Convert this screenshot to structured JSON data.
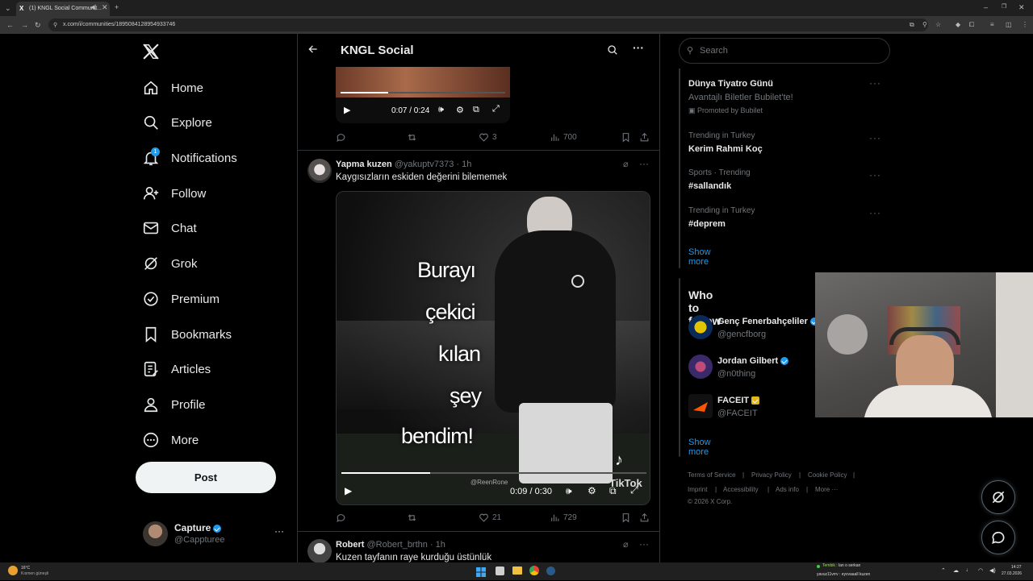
{
  "browser": {
    "tab_title": "(1) KNGL Social Communit...",
    "url": "x.com/i/communities/1895084128954933746"
  },
  "nav": {
    "items": [
      {
        "label": "Home"
      },
      {
        "label": "Explore"
      },
      {
        "label": "Notifications",
        "badge": "1"
      },
      {
        "label": "Follow"
      },
      {
        "label": "Chat"
      },
      {
        "label": "Grok"
      },
      {
        "label": "Premium"
      },
      {
        "label": "Bookmarks"
      },
      {
        "label": "Articles"
      },
      {
        "label": "Profile"
      },
      {
        "label": "More"
      }
    ],
    "post_label": "Post"
  },
  "account": {
    "name": "Capture",
    "handle": "@Cappturee"
  },
  "header": {
    "title": "KNGL Social"
  },
  "tweet1": {
    "video_time": "0:07 / 0:24",
    "video_progress": 0.29,
    "likes": "3",
    "views": "700"
  },
  "tweet2": {
    "name": "Yapma kuzen",
    "handle": "@yakuptv7373",
    "time": "· 1h",
    "text": "Kaygısızların eskiden değerini bilememek",
    "overlay": [
      "Burayı",
      "çekici",
      "kılan",
      "şey",
      "bendim!"
    ],
    "watermark_handle": "@ReenRone",
    "watermark_brand": "TikTok",
    "video_time": "0:09 / 0:30",
    "video_progress": 0.29,
    "likes": "21",
    "views": "729"
  },
  "tweet3": {
    "name": "Robert",
    "handle": "@Robert_brthn",
    "time": "· 1h",
    "text": "Kuzen tayfanın raye kurduğu üstünlük"
  },
  "search": {
    "placeholder": "Search"
  },
  "trends": {
    "promo_title": "Dünya Tiyatro Günü",
    "promo_sub": "Avantajlı Biletler Bubilet'te!",
    "promo_by": "Promoted by Bubilet",
    "items": [
      {
        "context": "Trending in Turkey",
        "title": "Kerim Rahmi Koç"
      },
      {
        "context": "Sports · Trending",
        "title": "#sallandık"
      },
      {
        "context": "Trending in Turkey",
        "title": "#deprem"
      }
    ],
    "show_more": "Show more"
  },
  "who_to_follow": {
    "title": "Who to follow",
    "accounts": [
      {
        "name": "Genç Fenerbahçeliler",
        "handle": "@gencfborg"
      },
      {
        "name": "Jordan Gilbert",
        "handle": "@n0thing"
      },
      {
        "name": "FACEIT",
        "handle": "@FACEIT"
      }
    ],
    "show_more": "Show more"
  },
  "footer": {
    "links": [
      "Terms of Service",
      "Privacy Policy",
      "Cookie Policy",
      "Imprint",
      "Accessibility",
      "Ads info",
      "More ···"
    ],
    "copyright": "© 2026 X Corp."
  },
  "taskbar": {
    "weather_temp": "16°C",
    "weather_desc": "Kısmen güneşli",
    "chat_line1_user": "Tembik",
    "chat_line1_msg": ": lan o serkan",
    "chat_line2": "yavuz11vrrv : eyvvaaall kuzen",
    "clock_time": "14:27",
    "clock_date": "27.03.2026"
  },
  "colors": {
    "accent": "#1d9bf0",
    "border": "#2f3336",
    "muted": "#71767b"
  }
}
